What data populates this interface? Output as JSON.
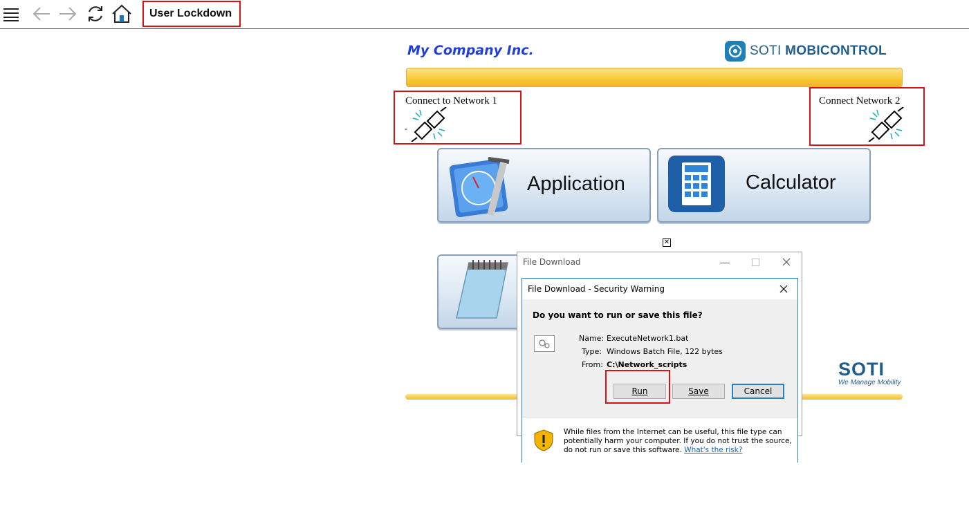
{
  "toolbar": {
    "menu_icon": "hamburger-menu-icon",
    "back_icon": "arrow-left-icon",
    "forward_icon": "arrow-right-icon",
    "refresh_icon": "refresh-icon",
    "home_icon": "home-icon",
    "title": "User Lockdown"
  },
  "header": {
    "company": "My Company Inc.",
    "logo_text_regular": "SOTI ",
    "logo_text_bold": "MOBICONTROL"
  },
  "networks": [
    {
      "label": "Connect to Network 1",
      "extra": "\""
    },
    {
      "label": "Connect Network 2"
    }
  ],
  "tiles": [
    {
      "label": "Application",
      "icon": "application-tools-icon"
    },
    {
      "label": "Calculator",
      "icon": "calculator-icon"
    },
    {
      "label": "",
      "icon": "notepad-icon"
    }
  ],
  "footer_logo": {
    "main": "SOTI",
    "tagline": "We Manage Mobility"
  },
  "outer_dialog": {
    "title": "File Download"
  },
  "dialog": {
    "title": "File Download - Security Warning",
    "question": "Do you want to run or save this file?",
    "fields": [
      {
        "label": "Name:",
        "value": "ExecuteNetwork1.bat"
      },
      {
        "label": "Type:",
        "value": "Windows Batch File, 122 bytes"
      },
      {
        "label": "From:",
        "value": "C:\\Network_scripts"
      }
    ],
    "buttons": {
      "run": "Run",
      "save": "Save",
      "cancel": "Cancel"
    },
    "warning_text": "While files from the Internet can be useful, this file type can potentially harm your computer. If you do not trust the source, do not run or save this software. ",
    "risk_link": "What's the risk?"
  },
  "colors": {
    "highlight": "#dd1111",
    "company": "#1f3fd9",
    "accent_blue": "#2b7fc2",
    "yellow_bar": "#f7c832"
  }
}
